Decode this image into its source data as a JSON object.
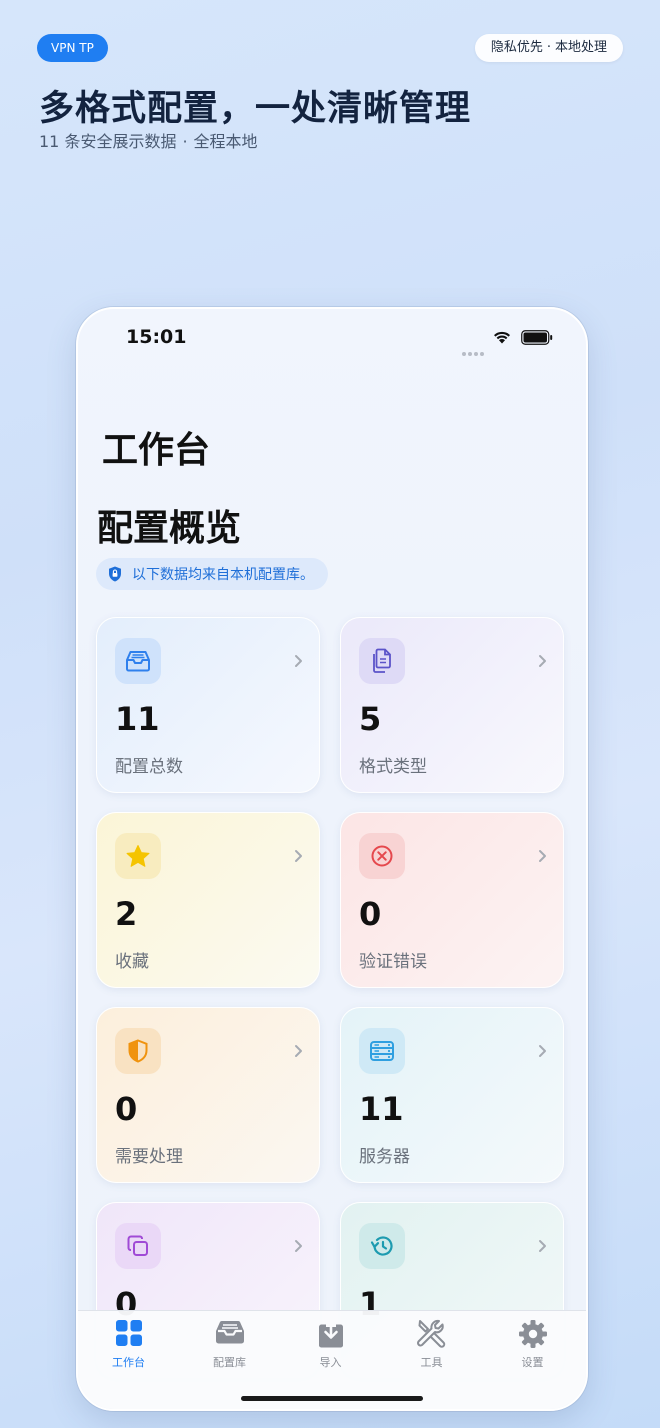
{
  "header": {
    "brand": "VPN TP",
    "privacy": [
      "隐私优先",
      "·",
      "本地处理"
    ],
    "headline": "多格式配置，一处清晰管理",
    "subline": [
      "11 条安全展示数据",
      "·",
      "全程本地"
    ]
  },
  "statusbar": {
    "time": "15:01"
  },
  "page": {
    "title": "工作台",
    "section_title": "配置概览",
    "notice": "以下数据均来自本机配置库。"
  },
  "cards": [
    {
      "value": "11",
      "label": "配置总数",
      "icon": "inbox-tray-icon",
      "color": "#2f80ed"
    },
    {
      "value": "5",
      "label": "格式类型",
      "icon": "documents-icon",
      "color": "#5b53c9"
    },
    {
      "value": "2",
      "label": "收藏",
      "icon": "star-icon",
      "color": "#f5c400"
    },
    {
      "value": "0",
      "label": "验证错误",
      "icon": "error-circle-icon",
      "color": "#e5484d"
    },
    {
      "value": "0",
      "label": "需要处理",
      "icon": "half-shield-icon",
      "color": "#f0930e"
    },
    {
      "value": "11",
      "label": "服务器",
      "icon": "server-icon",
      "color": "#2f9fe0"
    },
    {
      "value": "0",
      "label": "",
      "icon": "duplicate-icon",
      "color": "#a04ad6"
    },
    {
      "value": "1",
      "label": "",
      "icon": "history-icon",
      "color": "#1e9bb0"
    }
  ],
  "tabbar": {
    "tabs": [
      {
        "label": "工作台",
        "icon": "grid-icon",
        "active": true
      },
      {
        "label": "配置库",
        "icon": "tray-icon",
        "active": false
      },
      {
        "label": "导入",
        "icon": "download-icon",
        "active": false
      },
      {
        "label": "工具",
        "icon": "wrench-screwdriver-icon",
        "active": false
      },
      {
        "label": "设置",
        "icon": "gear-icon",
        "active": false
      }
    ],
    "active_color": "#1f7ef2",
    "inactive_color": "#8a8e96"
  }
}
